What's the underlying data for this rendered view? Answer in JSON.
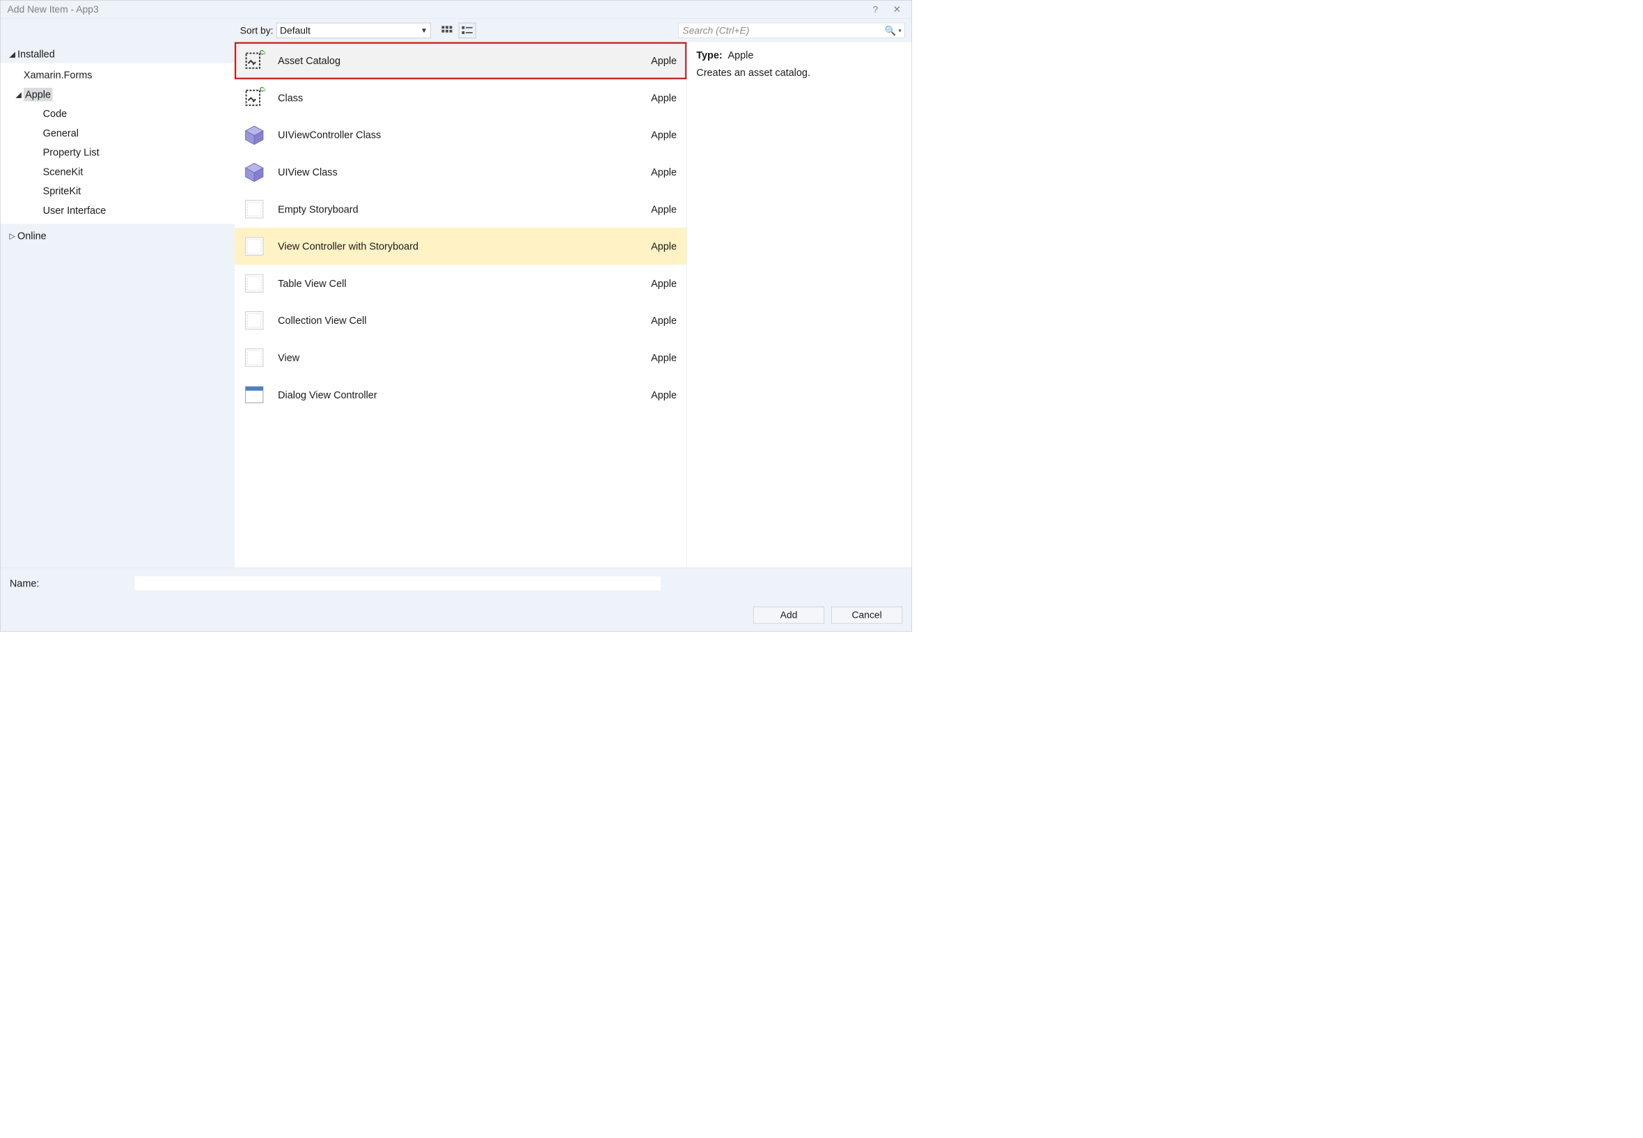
{
  "window": {
    "title": "Add New Item - App3",
    "help_tooltip": "?",
    "close_tooltip": "✕"
  },
  "toolbar": {
    "sort_by_label": "Sort by:",
    "sort_by_value": "Default",
    "search_placeholder": "Search (Ctrl+E)"
  },
  "sidebar": {
    "installed_label": "Installed",
    "online_label": "Online",
    "items": [
      {
        "label": "Xamarin.Forms",
        "depth": 1
      },
      {
        "label": "Apple",
        "depth": 1,
        "expanded": true,
        "selected": true
      },
      {
        "label": "Code",
        "depth": 2
      },
      {
        "label": "General",
        "depth": 2
      },
      {
        "label": "Property List",
        "depth": 2
      },
      {
        "label": "SceneKit",
        "depth": 2
      },
      {
        "label": "SpriteKit",
        "depth": 2
      },
      {
        "label": "User Interface",
        "depth": 2
      }
    ]
  },
  "templates": [
    {
      "name": "Asset Catalog",
      "category": "Apple",
      "icon": "csharp-asset",
      "selected": true
    },
    {
      "name": "Class",
      "category": "Apple",
      "icon": "csharp-asset"
    },
    {
      "name": "UIViewController Class",
      "category": "Apple",
      "icon": "cube"
    },
    {
      "name": "UIView Class",
      "category": "Apple",
      "icon": "cube"
    },
    {
      "name": "Empty Storyboard",
      "category": "Apple",
      "icon": "blank"
    },
    {
      "name": "View Controller with Storyboard",
      "category": "Apple",
      "icon": "blank",
      "highlight": true
    },
    {
      "name": "Table View Cell",
      "category": "Apple",
      "icon": "blank"
    },
    {
      "name": "Collection View Cell",
      "category": "Apple",
      "icon": "blank"
    },
    {
      "name": "View",
      "category": "Apple",
      "icon": "blank"
    },
    {
      "name": "Dialog View Controller",
      "category": "Apple",
      "icon": "window"
    }
  ],
  "preview": {
    "type_label": "Type:",
    "type_value": "Apple",
    "description": "Creates an asset catalog."
  },
  "footer": {
    "name_label": "Name:",
    "name_value": "",
    "add_label": "Add",
    "cancel_label": "Cancel"
  }
}
